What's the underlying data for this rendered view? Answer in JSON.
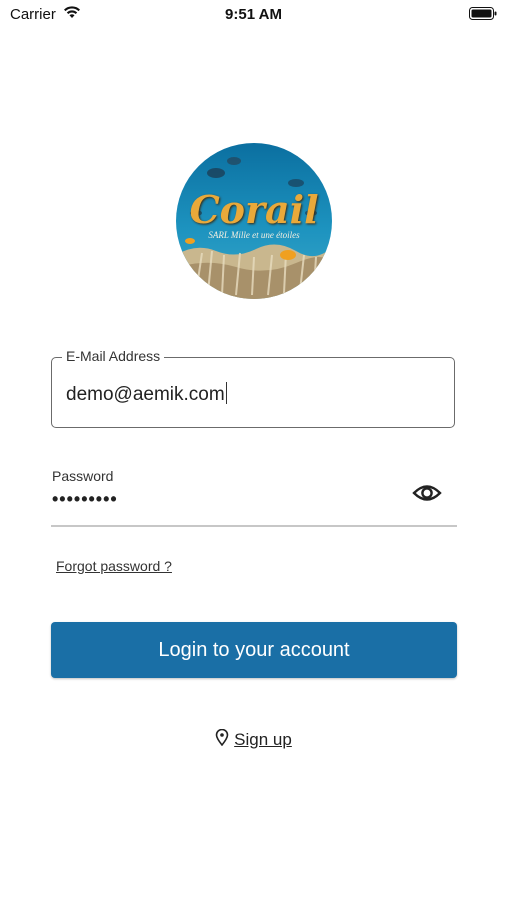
{
  "status_bar": {
    "carrier": "Carrier",
    "time": "9:51 AM",
    "icons": [
      "wifi-icon",
      "battery-icon"
    ]
  },
  "logo": {
    "title": "Corail",
    "subtitle": "SARL Mille et une étoiles"
  },
  "form": {
    "email": {
      "label": "E-Mail Address",
      "value": "demo@aemik.com"
    },
    "password": {
      "label": "Password",
      "value": "•••••••••",
      "toggle_icon": "eye-icon"
    },
    "forgot_label": "Forgot password ?",
    "login_label": "Login to your account",
    "signup_label": "Sign up",
    "signup_icon": "location-pin-icon"
  },
  "colors": {
    "primary": "#1a6fa6",
    "border": "#6b6b6b",
    "underline": "#c7c7c7"
  }
}
